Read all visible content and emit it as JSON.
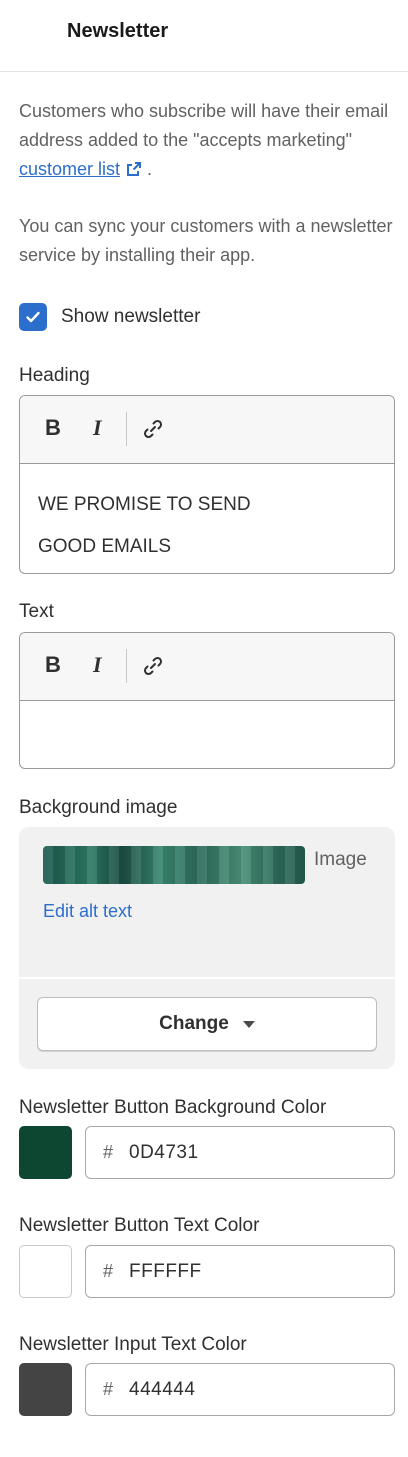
{
  "header": {
    "title": "Newsletter"
  },
  "description": {
    "para1_before": "Customers who subscribe will have their email address added to the \"accepts marketing\" ",
    "para1_link": "customer list",
    "para1_after": " .",
    "para2": "You can sync your customers with a newsletter service by installing their app."
  },
  "show_newsletter": {
    "label": "Show newsletter",
    "checked": true
  },
  "heading_field": {
    "label": "Heading",
    "toolbar": {
      "bold": "B",
      "italic": "I"
    },
    "lines": [
      "WE PROMISE TO SEND",
      "GOOD EMAILS"
    ]
  },
  "text_field": {
    "label": "Text",
    "toolbar": {
      "bold": "B",
      "italic": "I"
    },
    "content": ""
  },
  "background_image": {
    "label": "Background image",
    "image_label": "Image",
    "edit_alt": "Edit alt text",
    "change_label": "Change"
  },
  "colors": {
    "button_bg": {
      "label": "Newsletter Button Background Color",
      "hash": "#",
      "value": "0D4731",
      "swatch": "#0D4731"
    },
    "button_text": {
      "label": "Newsletter Button Text Color",
      "hash": "#",
      "value": "FFFFFF",
      "swatch": "#FFFFFF"
    },
    "input_text": {
      "label": "Newsletter Input Text Color",
      "hash": "#",
      "value": "444444",
      "swatch": "#444444"
    }
  },
  "theme": {
    "accent": "#2c6ecb"
  }
}
